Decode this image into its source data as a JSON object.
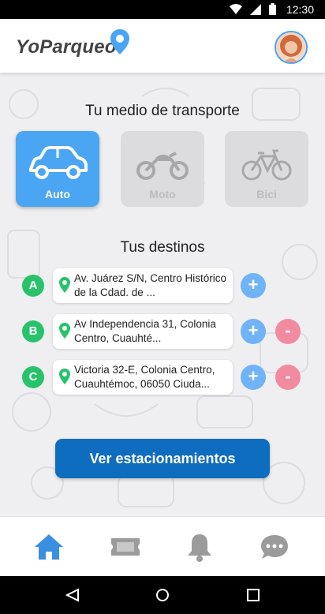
{
  "status_bar": {
    "time": "12:30",
    "icons": [
      "wifi-icon",
      "signal-icon",
      "battery-icon"
    ]
  },
  "header": {
    "app_name": "YoParqueo",
    "logo_icon": "location-pin-icon",
    "avatar_icon": "user-avatar"
  },
  "transport": {
    "title": "Tu medio de transporte",
    "options": [
      {
        "label": "Auto",
        "icon": "car-icon",
        "selected": true
      },
      {
        "label": "Moto",
        "icon": "motorcycle-icon",
        "selected": false
      },
      {
        "label": "Bici",
        "icon": "bicycle-icon",
        "selected": false
      }
    ]
  },
  "destinations": {
    "title": "Tus destinos",
    "items": [
      {
        "letter": "A",
        "address": "Av. Juárez S/N, Centro Histórico de la Cdad. de ...",
        "add": "+"
      },
      {
        "letter": "B",
        "address": "Av Independencia 31, Colonia Centro, Cuauhté...",
        "add": "+",
        "remove": "-"
      },
      {
        "letter": "C",
        "address": "Victoria 32-E, Colonia Centro, Cuauhtémoc, 06050 Ciuda...",
        "add": "+",
        "remove": "-"
      }
    ]
  },
  "cta": {
    "label": "Ver estacionamientos"
  },
  "tabbar": {
    "items": [
      "home-icon",
      "ticket-icon",
      "bell-icon",
      "chat-icon"
    ],
    "active": "home-icon"
  },
  "colors": {
    "primary": "#0f6dbf",
    "accent": "#4aa6f3",
    "green": "#27c36b",
    "pink": "#f28ba0"
  }
}
